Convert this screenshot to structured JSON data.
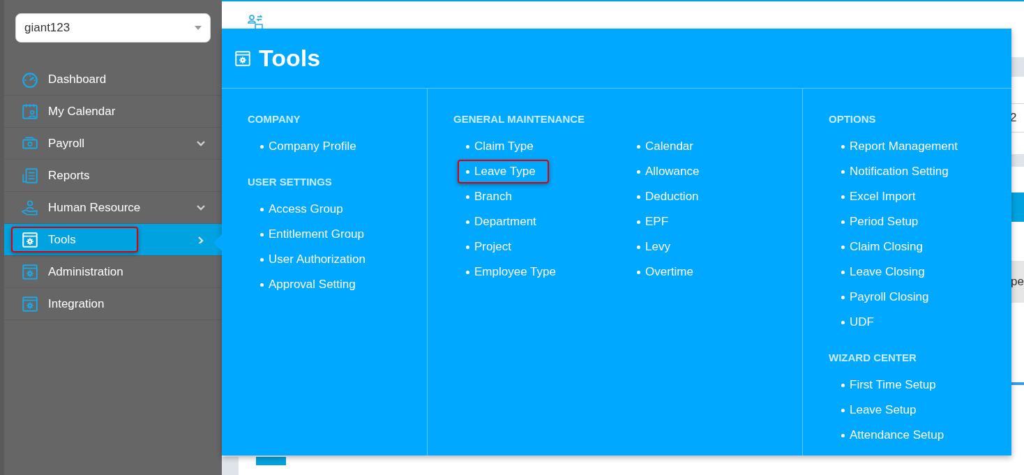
{
  "account_select": {
    "value": "giant123"
  },
  "sidebar": {
    "items": [
      {
        "label": "Dashboard",
        "kind": "dashboard",
        "has_submenu": false,
        "selected": false,
        "highlighted": false
      },
      {
        "label": "My Calendar",
        "kind": "calendar",
        "has_submenu": false,
        "selected": false,
        "highlighted": false
      },
      {
        "label": "Payroll",
        "kind": "payroll",
        "has_submenu": true,
        "selected": false,
        "highlighted": false
      },
      {
        "label": "Reports",
        "kind": "reports",
        "has_submenu": false,
        "selected": false,
        "highlighted": false
      },
      {
        "label": "Human Resource",
        "kind": "hr",
        "has_submenu": true,
        "selected": false,
        "highlighted": false
      },
      {
        "label": "Tools",
        "kind": "tools",
        "has_submenu": true,
        "selected": true,
        "highlighted": true
      },
      {
        "label": "Administration",
        "kind": "tools",
        "has_submenu": false,
        "selected": false,
        "highlighted": false
      },
      {
        "label": "Integration",
        "kind": "tools",
        "has_submenu": false,
        "selected": false,
        "highlighted": false
      }
    ]
  },
  "page": {
    "cut_cells": [
      "2",
      "pe"
    ]
  },
  "tools_menu": {
    "title": "Tools",
    "columns": [
      {
        "sections": [
          {
            "heading": "COMPANY",
            "item_columns": [
              [
                {
                  "label": "Company Profile",
                  "highlighted": false
                }
              ]
            ]
          },
          {
            "heading": "USER SETTINGS",
            "item_columns": [
              [
                {
                  "label": "Access Group",
                  "highlighted": false
                },
                {
                  "label": "Entitlement Group",
                  "highlighted": false
                },
                {
                  "label": "User Authorization",
                  "highlighted": false
                },
                {
                  "label": "Approval Setting",
                  "highlighted": false
                }
              ]
            ]
          }
        ]
      },
      {
        "sections": [
          {
            "heading": "GENERAL MAINTENANCE",
            "item_columns": [
              [
                {
                  "label": "Claim Type",
                  "highlighted": false
                },
                {
                  "label": "Leave Type",
                  "highlighted": true
                },
                {
                  "label": "Branch",
                  "highlighted": false
                },
                {
                  "label": "Department",
                  "highlighted": false
                },
                {
                  "label": "Project",
                  "highlighted": false
                },
                {
                  "label": "Employee Type",
                  "highlighted": false
                }
              ],
              [
                {
                  "label": "Calendar",
                  "highlighted": false
                },
                {
                  "label": "Allowance",
                  "highlighted": false
                },
                {
                  "label": "Deduction",
                  "highlighted": false
                },
                {
                  "label": "EPF",
                  "highlighted": false
                },
                {
                  "label": "Levy",
                  "highlighted": false
                },
                {
                  "label": "Overtime",
                  "highlighted": false
                }
              ]
            ]
          }
        ]
      },
      {
        "sections": [
          {
            "heading": "OPTIONS",
            "item_columns": [
              [
                {
                  "label": "Report Management",
                  "highlighted": false
                },
                {
                  "label": "Notification Setting",
                  "highlighted": false
                },
                {
                  "label": "Excel Import",
                  "highlighted": false
                },
                {
                  "label": "Period Setup",
                  "highlighted": false
                },
                {
                  "label": "Claim Closing",
                  "highlighted": false
                },
                {
                  "label": "Leave Closing",
                  "highlighted": false
                },
                {
                  "label": "Payroll Closing",
                  "highlighted": false
                },
                {
                  "label": "UDF",
                  "highlighted": false
                }
              ]
            ]
          },
          {
            "heading": "WIZARD CENTER",
            "item_columns": [
              [
                {
                  "label": "First Time Setup",
                  "highlighted": false
                },
                {
                  "label": "Leave Setup",
                  "highlighted": false
                },
                {
                  "label": "Attendance Setup",
                  "highlighted": false
                }
              ]
            ]
          }
        ]
      }
    ]
  }
}
